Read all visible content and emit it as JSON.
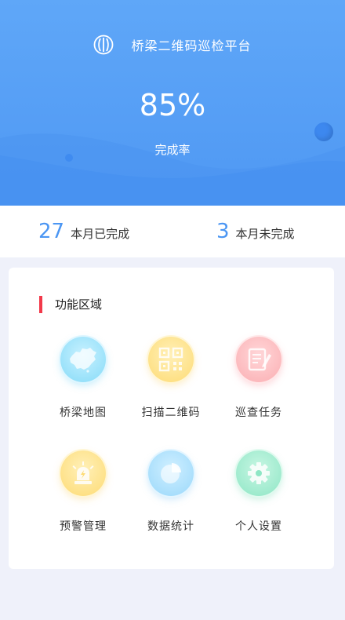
{
  "header": {
    "app_title": "桥梁二维码巡检平台",
    "completion_rate": "85%",
    "completion_label": "完成率",
    "logo_icon": "bridge-logo-icon"
  },
  "stats": {
    "completed": {
      "value": "27",
      "label": "本月已完成"
    },
    "uncompleted": {
      "value": "3",
      "label": "本月未完成"
    }
  },
  "functions": {
    "title": "功能区域",
    "accent_color": "#f2394a",
    "items": [
      {
        "label": "桥梁地图",
        "icon": "china-map-icon"
      },
      {
        "label": "扫描二维码",
        "icon": "qr-code-icon"
      },
      {
        "label": "巡查任务",
        "icon": "task-edit-icon"
      },
      {
        "label": "预警管理",
        "icon": "alarm-light-icon"
      },
      {
        "label": "数据统计",
        "icon": "pie-chart-icon"
      },
      {
        "label": "个人设置",
        "icon": "gear-icon"
      }
    ]
  },
  "colors": {
    "primary": "#4f98f3",
    "background": "#eff1fa"
  }
}
